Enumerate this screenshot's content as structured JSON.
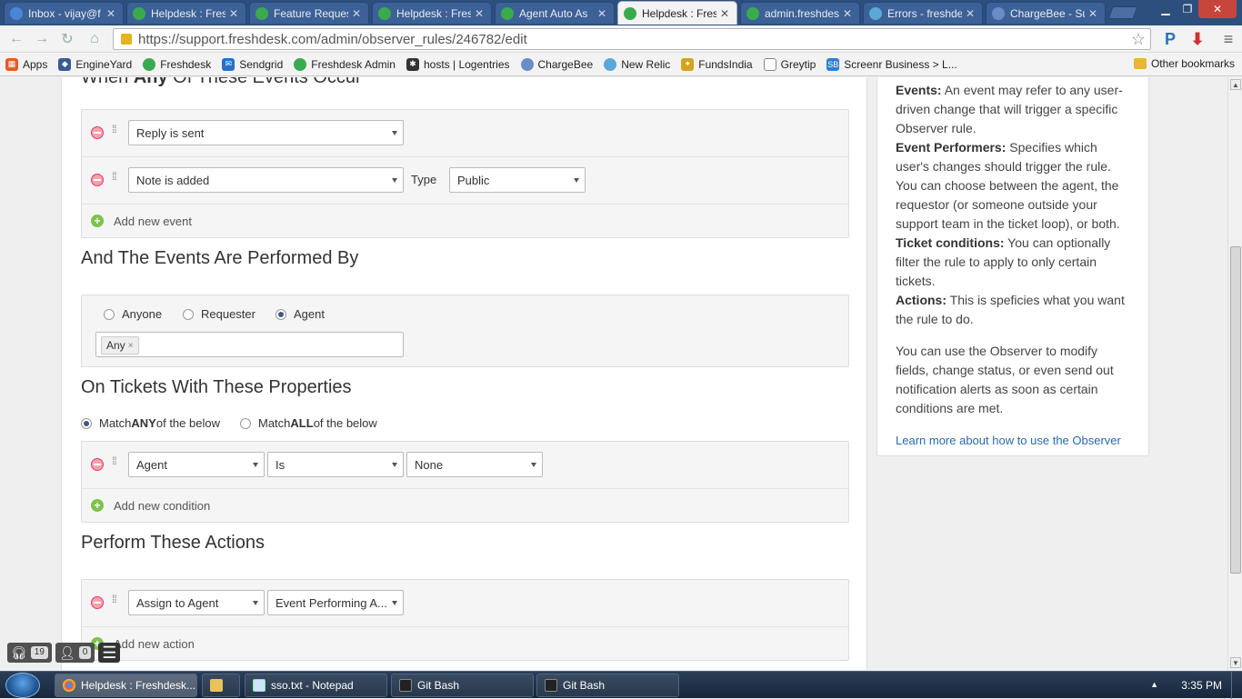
{
  "browser": {
    "tabs": [
      {
        "title": "Inbox - vijay@f",
        "icon": "gmail-icon",
        "color": "#4a86d8"
      },
      {
        "title": "Helpdesk : Fres",
        "icon": "freshdesk-icon",
        "color": "#3aaa4f"
      },
      {
        "title": "Feature Reques",
        "icon": "freshdesk-icon",
        "color": "#3aaa4f"
      },
      {
        "title": "Helpdesk : Fres",
        "icon": "freshdesk-icon",
        "color": "#3aaa4f"
      },
      {
        "title": "Agent Auto As",
        "icon": "freshdesk-icon",
        "color": "#3aaa4f"
      },
      {
        "title": "Helpdesk : Fres",
        "icon": "freshdesk-icon",
        "color": "#3aaa4f",
        "active": true
      },
      {
        "title": "admin.freshdes",
        "icon": "freshdesk-icon",
        "color": "#3aaa4f"
      },
      {
        "title": "Errors - freshde",
        "icon": "newrelic-icon",
        "color": "#5ba7d8"
      },
      {
        "title": "ChargeBee - Su",
        "icon": "chargebee-icon",
        "color": "#6b8cc7"
      }
    ],
    "url": "https://support.freshdesk.com/admin/observer_rules/246782/edit",
    "bookmarks": [
      {
        "label": "Apps",
        "icon": "apps-grid-icon",
        "color": "#e25b2b"
      },
      {
        "label": "EngineYard",
        "icon": "engineyard-icon",
        "color": "#3b5b8f"
      },
      {
        "label": "Freshdesk",
        "icon": "freshdesk-icon",
        "color": "#3aaa4f"
      },
      {
        "label": "Sendgrid",
        "icon": "sendgrid-icon",
        "color": "#2b6fc7"
      },
      {
        "label": "Freshdesk Admin",
        "icon": "freshdesk-icon",
        "color": "#3aaa4f"
      },
      {
        "label": "hosts | Logentries",
        "icon": "logentries-icon",
        "color": "#333333"
      },
      {
        "label": "ChargeBee",
        "icon": "chargebee-icon",
        "color": "#6b8cc7"
      },
      {
        "label": "New Relic",
        "icon": "newrelic-icon",
        "color": "#5ba7d8"
      },
      {
        "label": "FundsIndia",
        "icon": "fundsindia-icon",
        "color": "#d4a21b"
      },
      {
        "label": "Greytip",
        "icon": "page-icon",
        "color": "#888888"
      },
      {
        "label": "Screenr Business > L...",
        "icon": "screenr-icon",
        "color": "#2a7fd4"
      }
    ],
    "other_bookmarks": "Other bookmarks"
  },
  "events_section": {
    "title_pre": "When ",
    "title_bold": "Any",
    "title_post": " Of These Events Occur",
    "rows": [
      {
        "event": "Reply is sent"
      },
      {
        "event": "Note is added",
        "type_label": "Type",
        "type_value": "Public"
      }
    ],
    "add_label": "Add new event"
  },
  "performers_section": {
    "title": "And The Events Are Performed By",
    "options": [
      {
        "label": "Anyone",
        "selected": false
      },
      {
        "label": "Requester",
        "selected": false
      },
      {
        "label": "Agent",
        "selected": true
      }
    ],
    "tag": "Any",
    "tag_remove": "×"
  },
  "conditions_section": {
    "title": "On Tickets With These Properties",
    "match_any_pre": "Match ",
    "match_any_bold": "ANY",
    "match_any_post": " of the below",
    "match_all_pre": "Match ",
    "match_all_bold": "ALL",
    "match_all_post": " of the below",
    "match_any_selected": true,
    "row": {
      "field": "Agent",
      "operator": "Is",
      "value": "None"
    },
    "add_label": "Add new condition"
  },
  "actions_section": {
    "title": "Perform These Actions",
    "row": {
      "action": "Assign to Agent",
      "value": "Event Performing A..."
    },
    "add_label": "Add new action"
  },
  "help": {
    "events_term": "Events:",
    "events_text": " An event may refer to any user-driven change that will trigger a specific Observer rule.",
    "performers_term": "Event Performers:",
    "performers_text": " Specifies which user's changes should trigger the rule. You can choose between the agent, the requestor (or someone outside your support team in the ticket loop), or both.",
    "conditions_term": "Ticket conditions:",
    "conditions_text": " You can optionally filter the rule to apply to only certain tickets.",
    "actions_term": "Actions:",
    "actions_text": " This is speficies what you want the rule to do.",
    "paragraph": "You can use the Observer to modify fields, change status, or even send out notification alerts as soon as certain conditions are met.",
    "link": "Learn more about how to use the Observer"
  },
  "widget": {
    "tickets_count": "19",
    "agents_count": "0"
  },
  "taskbar": {
    "items": [
      {
        "label": "Helpdesk : Freshdesk...",
        "icon": "chrome-icon",
        "active": true
      },
      {
        "label": "",
        "icon": "explorer-icon"
      },
      {
        "label": "sso.txt - Notepad",
        "icon": "notepad-icon"
      },
      {
        "label": "Git Bash",
        "icon": "gitbash-icon"
      },
      {
        "label": "Git Bash",
        "icon": "gitbash-icon"
      }
    ],
    "clock": "3:35 PM"
  },
  "colors": {
    "accent_link": "#2a6aaf",
    "add_green": "#7ec34b",
    "remove_red": "#f3a4a4"
  }
}
